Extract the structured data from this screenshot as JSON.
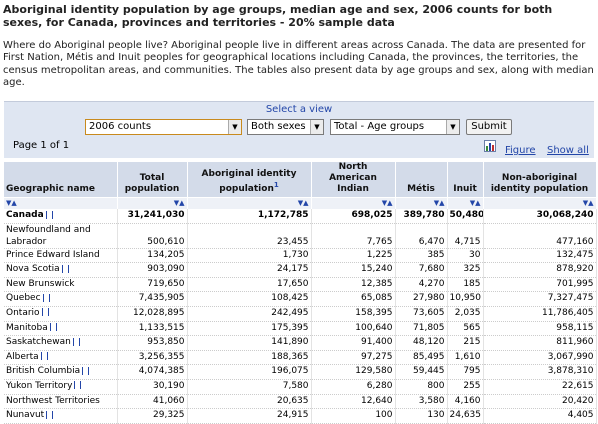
{
  "title": "Aboriginal identity population by age groups, median age and sex, 2006 counts for both sexes, for Canada, provinces and territories - 20% sample data",
  "intro": "Where do Aboriginal people live? Aboriginal people live in different areas across Canada. The data are presented for First Nation, Métis and Inuit peoples for geographical locations including Canada, the provinces, the territories, the census metropolitan areas, and communities. The tables also present data by age groups and sex, along with median age.",
  "controls": {
    "select_view_label": "Select a view",
    "count_value": "2006 counts",
    "sex_value": "Both sexes",
    "age_value": "Total - Age groups",
    "submit_label": "Submit",
    "page_of": "Page 1 of 1",
    "figure_link": "Figure",
    "show_all_link": "Show all"
  },
  "table": {
    "headers": [
      "Geographic name",
      "Total population",
      "Aboriginal identity population",
      "North American Indian",
      "Métis",
      "Inuit",
      "Non-aboriginal identity population"
    ],
    "footnote_marker": "1",
    "sort_glyph": "▼▲",
    "rows": [
      {
        "name": "Canada",
        "info": true,
        "total": "31,241,030",
        "aboriginal": "1,172,785",
        "nai": "698,025",
        "metis": "389,780",
        "inuit": "50,480",
        "non": "30,068,240"
      },
      {
        "name": "Newfoundland and Labrador",
        "info": false,
        "total": "500,610",
        "aboriginal": "23,455",
        "nai": "7,765",
        "metis": "6,470",
        "inuit": "4,715",
        "non": "477,160"
      },
      {
        "name": "Prince Edward Island",
        "info": false,
        "total": "134,205",
        "aboriginal": "1,730",
        "nai": "1,225",
        "metis": "385",
        "inuit": "30",
        "non": "132,475"
      },
      {
        "name": "Nova Scotia",
        "info": true,
        "total": "903,090",
        "aboriginal": "24,175",
        "nai": "15,240",
        "metis": "7,680",
        "inuit": "325",
        "non": "878,920"
      },
      {
        "name": "New Brunswick",
        "info": false,
        "total": "719,650",
        "aboriginal": "17,650",
        "nai": "12,385",
        "metis": "4,270",
        "inuit": "185",
        "non": "701,995"
      },
      {
        "name": "Quebec",
        "info": true,
        "total": "7,435,905",
        "aboriginal": "108,425",
        "nai": "65,085",
        "metis": "27,980",
        "inuit": "10,950",
        "non": "7,327,475"
      },
      {
        "name": "Ontario",
        "info": true,
        "total": "12,028,895",
        "aboriginal": "242,495",
        "nai": "158,395",
        "metis": "73,605",
        "inuit": "2,035",
        "non": "11,786,405"
      },
      {
        "name": "Manitoba",
        "info": true,
        "total": "1,133,515",
        "aboriginal": "175,395",
        "nai": "100,640",
        "metis": "71,805",
        "inuit": "565",
        "non": "958,115"
      },
      {
        "name": "Saskatchewan",
        "info": true,
        "total": "953,850",
        "aboriginal": "141,890",
        "nai": "91,400",
        "metis": "48,120",
        "inuit": "215",
        "non": "811,960"
      },
      {
        "name": "Alberta",
        "info": true,
        "total": "3,256,355",
        "aboriginal": "188,365",
        "nai": "97,275",
        "metis": "85,495",
        "inuit": "1,610",
        "non": "3,067,990"
      },
      {
        "name": "British Columbia",
        "info": true,
        "total": "4,074,385",
        "aboriginal": "196,075",
        "nai": "129,580",
        "metis": "59,445",
        "inuit": "795",
        "non": "3,878,310"
      },
      {
        "name": "Yukon Territory",
        "info": true,
        "total": "30,190",
        "aboriginal": "7,580",
        "nai": "6,280",
        "metis": "800",
        "inuit": "255",
        "non": "22,615"
      },
      {
        "name": "Northwest Territories",
        "info": false,
        "total": "41,060",
        "aboriginal": "20,635",
        "nai": "12,640",
        "metis": "3,580",
        "inuit": "4,160",
        "non": "20,420"
      },
      {
        "name": "Nunavut",
        "info": true,
        "total": "29,325",
        "aboriginal": "24,915",
        "nai": "100",
        "metis": "130",
        "inuit": "24,635",
        "non": "4,405"
      }
    ]
  }
}
